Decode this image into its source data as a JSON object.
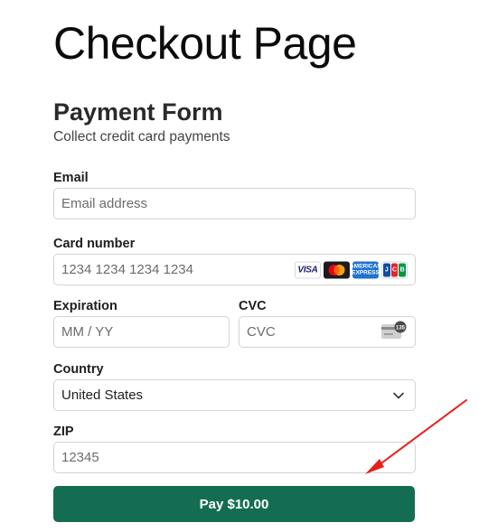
{
  "page": {
    "title": "Checkout Page"
  },
  "form": {
    "title": "Payment Form",
    "subtitle": "Collect credit card payments",
    "email": {
      "label": "Email",
      "placeholder": "Email address"
    },
    "card": {
      "label": "Card number",
      "placeholder": "1234 1234 1234 1234",
      "brands": [
        {
          "name": "visa",
          "text": "VISA"
        },
        {
          "name": "mastercard"
        },
        {
          "name": "amex",
          "text": "AMERICAN EXPRESS"
        },
        {
          "name": "jcb",
          "text": "JCB"
        }
      ]
    },
    "expiration": {
      "label": "Expiration",
      "placeholder": "MM / YY"
    },
    "cvc": {
      "label": "CVC",
      "placeholder": "CVC",
      "icon_text": "135"
    },
    "country": {
      "label": "Country",
      "value": "United States"
    },
    "zip": {
      "label": "ZIP",
      "placeholder": "12345"
    },
    "pay_button": {
      "label": "Pay $10.00",
      "color": "#146d52"
    }
  },
  "annotation": {
    "arrow_color": "#e8201c"
  }
}
